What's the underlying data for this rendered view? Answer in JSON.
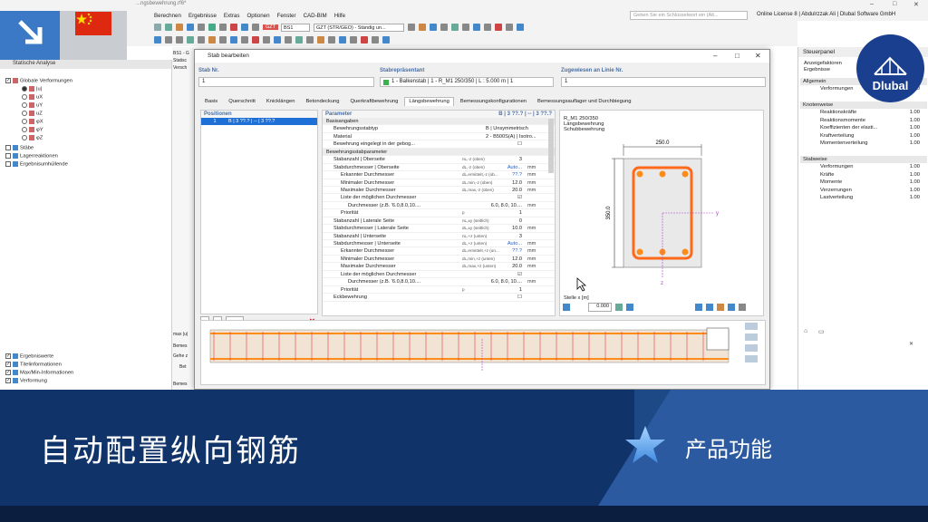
{
  "app": {
    "document_title": "...ngsbewehrung.rf6*",
    "menu": [
      "Berechnen",
      "Ergebnisse",
      "Extras",
      "Optionen",
      "Fenster",
      "CAD-BIM",
      "Hilfe"
    ],
    "search_placeholder": "Geben Sie ein Schlüsselwort ein (Alt...",
    "license": "Online License 8 | Abdulrzzak Ali | Dlubal Software GmbH",
    "toolbar": {
      "loadcase_badge": "GZT",
      "loadcase_id": "BS1",
      "loadcase_combo": "GZT (STR/GEO) - Ständig un..."
    }
  },
  "navigator": {
    "title": "Statische Analyse",
    "items": [
      {
        "label": "Globale Verformungen"
      },
      {
        "label": "|u|"
      },
      {
        "label": "uX"
      },
      {
        "label": "uY"
      },
      {
        "label": "uZ"
      },
      {
        "label": "φX"
      },
      {
        "label": "φY"
      },
      {
        "label": "φZ"
      },
      {
        "label": "Stäbe"
      },
      {
        "label": "Lagerreaktionen"
      },
      {
        "label": "Ergebnisumhüllende"
      }
    ],
    "bottom_items": [
      {
        "label": "Ergebniswerte"
      },
      {
        "label": "Titelinformationen"
      },
      {
        "label": "Max/Min-Informationen"
      },
      {
        "label": "Verformung"
      }
    ],
    "side_labels": [
      "BS1 - G",
      "Statisc",
      "Versch",
      "max |u|",
      "Bemes",
      "Gehe z",
      "Bet",
      "Bemes"
    ]
  },
  "control_panel": {
    "title": "Steuerpanel",
    "subtitle_1": "Anzeigefaktoren",
    "subtitle_2": "Ergebnisse",
    "sections": [
      {
        "name": "Allgemein",
        "rows": [
          {
            "label": "Verformungen",
            "value": "1.00"
          }
        ]
      },
      {
        "name": "Knotenweise",
        "rows": [
          {
            "label": "Reaktionskräfte",
            "value": "1.00"
          },
          {
            "label": "Reaktionsmomente",
            "value": "1.00"
          },
          {
            "label": "Koeffizienten der elasti...",
            "value": "1.00"
          },
          {
            "label": "Kraftverteilung",
            "value": "1.00"
          },
          {
            "label": "Momentenverteilung",
            "value": "1.00"
          }
        ]
      },
      {
        "name": "Stabweise",
        "rows": [
          {
            "label": "Verformungen",
            "value": "1.00"
          },
          {
            "label": "Kräfte",
            "value": "1.00"
          },
          {
            "label": "Momente",
            "value": "1.00"
          },
          {
            "label": "Verzerrungen",
            "value": "1.00"
          },
          {
            "label": "Lastverteilung",
            "value": "1.00"
          }
        ]
      }
    ]
  },
  "brand": {
    "name": "Dlubal"
  },
  "dialog": {
    "title": "Stab bearbeiten",
    "fields": {
      "stab_nr_label": "Stab Nr.",
      "stab_nr_value": "1",
      "repr_label": "Stabrepräsentant",
      "repr_value": "1 - Balkenstab | 1 - R_M1 250/350 | L : 5.000 m | 1",
      "linie_label": "Zugewiesen an Linie Nr.",
      "linie_value": "1"
    },
    "tabs": [
      "Basis",
      "Querschnitt",
      "Knicklängen",
      "Betondeckung",
      "Querkraftbewehrung",
      "Längsbewehrung",
      "Bemessungskonfigurationen",
      "Bemessungsauflager und Durchbiegung"
    ],
    "active_tab": "Längsbewehrung",
    "positions": {
      "title": "Positionen",
      "row_no": "1",
      "row_text": "B | 3 ??.? | -- | 3 ??.?"
    },
    "parameters": {
      "title": "Parameter",
      "summary": "B | 3 ??.? | -- | 3 ??.?",
      "rows": [
        {
          "indent": 0,
          "section": true,
          "label": "Basisangaben",
          "symbol": "",
          "value": "",
          "unit": ""
        },
        {
          "indent": 1,
          "label": "Bewehrungsstabtyp",
          "symbol": "",
          "value": "B | Unsymmetrisch",
          "unit": ""
        },
        {
          "indent": 1,
          "label": "Material",
          "symbol": "",
          "value": "2 - B500S(A) | Isotro...",
          "unit": ""
        },
        {
          "indent": 1,
          "label": "Bewehrung eingelegt in der gebog...",
          "symbol": "",
          "value": "☐",
          "unit": ""
        },
        {
          "indent": 0,
          "section": true,
          "label": "Bewehrungsstabparameter",
          "symbol": "",
          "value": "",
          "unit": ""
        },
        {
          "indent": 1,
          "label": "Stabanzahl | Oberseite",
          "symbol": "nL,-z (oben)",
          "value": "3",
          "unit": ""
        },
        {
          "indent": 1,
          "label": "Stabdurchmesser | Oberseite",
          "symbol": "dL,-z (oben)",
          "value": "Auto...",
          "unit": "mm",
          "link": true
        },
        {
          "indent": 2,
          "label": "Erkannter Durchmesser",
          "symbol": "dL,ermittelt,-z (ob...",
          "value": "??.?",
          "unit": "mm",
          "link": true
        },
        {
          "indent": 2,
          "label": "Minimaler Durchmesser",
          "symbol": "dL,min,-z (oben)",
          "value": "12.0",
          "unit": "mm"
        },
        {
          "indent": 2,
          "label": "Maximaler Durchmesser",
          "symbol": "dL,max,-z (oben)",
          "value": "20.0",
          "unit": "mm"
        },
        {
          "indent": 2,
          "label": "Liste der möglichen Durchmesser",
          "symbol": "",
          "value": "☑",
          "unit": ""
        },
        {
          "indent": 3,
          "label": "Durchmesser (z.B. '6.0,8.0,10....",
          "symbol": "",
          "value": "6.0, 8.0, 10....",
          "unit": "mm"
        },
        {
          "indent": 2,
          "label": "Priorität",
          "symbol": "p",
          "value": "1",
          "unit": ""
        },
        {
          "indent": 1,
          "label": "Stabanzahl | Laterale Seite",
          "symbol": "nL,±y (seitlich)",
          "value": "0",
          "unit": ""
        },
        {
          "indent": 1,
          "label": "Stabdurchmesser | Laterale Seite",
          "symbol": "dL,±y (seitlich)",
          "value": "10.0",
          "unit": "mm"
        },
        {
          "indent": 1,
          "label": "Stabanzahl | Unterseite",
          "symbol": "nL,+z (unten)",
          "value": "3",
          "unit": ""
        },
        {
          "indent": 1,
          "label": "Stabdurchmesser | Unterseite",
          "symbol": "dL,+z (unten)",
          "value": "Auto...",
          "unit": "mm",
          "link": true
        },
        {
          "indent": 2,
          "label": "Erkannter Durchmesser",
          "symbol": "dL,ermittelt,+z (un...",
          "value": "??.?",
          "unit": "mm",
          "link": true
        },
        {
          "indent": 2,
          "label": "Minimaler Durchmesser",
          "symbol": "dL,min,+z (unten)",
          "value": "12.0",
          "unit": "mm"
        },
        {
          "indent": 2,
          "label": "Maximaler Durchmesser",
          "symbol": "dL,max,+z (unten)",
          "value": "20.0",
          "unit": "mm"
        },
        {
          "indent": 2,
          "label": "Liste der möglichen Durchmesser",
          "symbol": "",
          "value": "☑",
          "unit": ""
        },
        {
          "indent": 3,
          "label": "Durchmesser (z.B. '6.0,8.0,10....",
          "symbol": "",
          "value": "6.0, 8.0, 10....",
          "unit": "mm"
        },
        {
          "indent": 2,
          "label": "Priorität",
          "symbol": "p",
          "value": "1",
          "unit": ""
        },
        {
          "indent": 1,
          "label": "Eckbewehrung",
          "symbol": "",
          "value": "☐",
          "unit": ""
        }
      ]
    },
    "preview": {
      "line1": "R_M1 250/350",
      "line2": "Längsbewehrung",
      "line3": "Schubbewehrung",
      "dim_width": "250.0",
      "dim_height": "350.0",
      "axis_y": "y",
      "axis_z": "z",
      "stelle_label": "Stelle x [m]",
      "stelle_value": "0.000"
    }
  },
  "banner": {
    "title": "自动配置纵向钢筋",
    "tag": "产品功能"
  },
  "colors": {
    "accent_blue": "#1f70d6",
    "rebar_orange": "#ff6a1a",
    "banner_dark": "#10336a",
    "banner_light": "#2b5aa0"
  }
}
